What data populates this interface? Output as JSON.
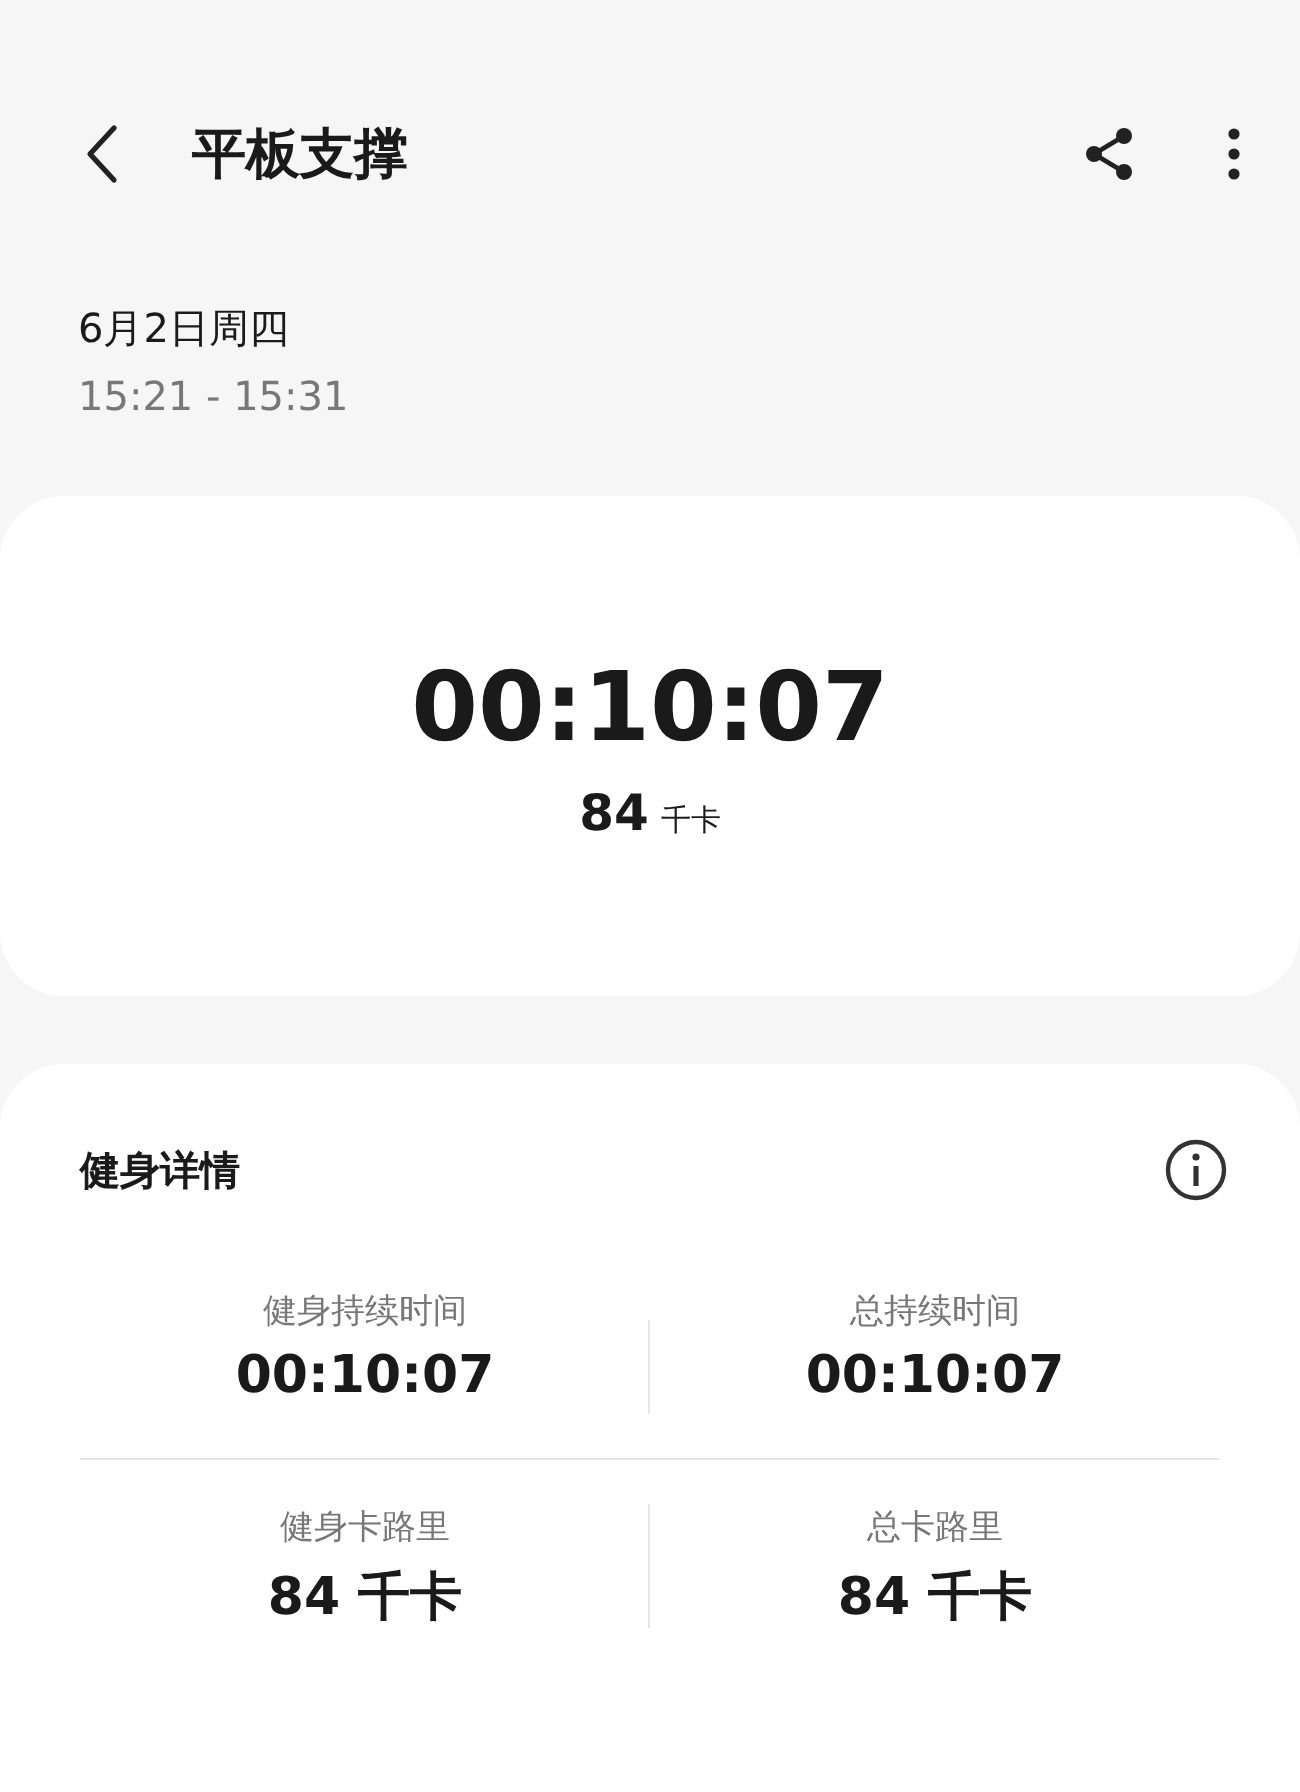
{
  "header": {
    "title": "平板支撑"
  },
  "session": {
    "date": "6月2日周四",
    "time_range": "15:21 - 15:31"
  },
  "summary": {
    "duration": "00:10:07",
    "calories": "84",
    "calories_unit": "千卡"
  },
  "details": {
    "title": "健身详情",
    "stats": [
      {
        "label": "健身持续时间",
        "value": "00:10:07"
      },
      {
        "label": "总持续时间",
        "value": "00:10:07"
      },
      {
        "label": "健身卡路里",
        "value": "84 千卡"
      },
      {
        "label": "总卡路里",
        "value": "84 千卡"
      }
    ]
  }
}
